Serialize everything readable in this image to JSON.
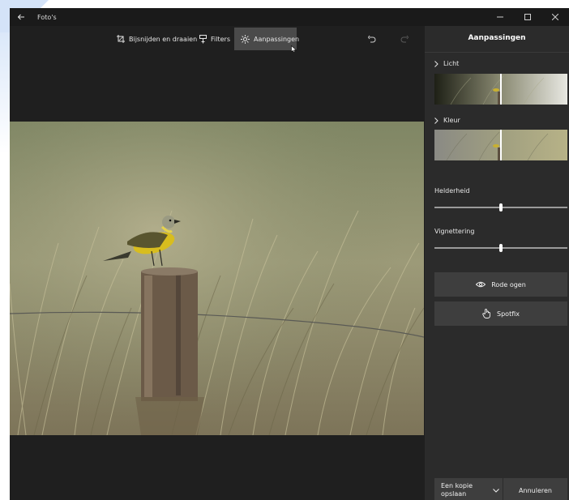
{
  "window": {
    "title": "Foto's",
    "back_icon": "arrow-left-icon",
    "controls": [
      "minimize-icon",
      "maximize-icon",
      "close-icon"
    ]
  },
  "toolbar": {
    "crop_label": "Bijsnijden en draaien",
    "filters_label": "Filters",
    "adjust_label": "Aanpassingen",
    "active_tab": "Aanpassingen"
  },
  "panel": {
    "title": "Aanpassingen",
    "light_label": "Licht",
    "color_label": "Kleur",
    "light_value": 0.5,
    "color_value": 0.5,
    "brightness_label": "Helderheid",
    "brightness_value": 0.5,
    "vignette_label": "Vignettering",
    "vignette_value": 0.5,
    "red_eye_label": "Rode ogen",
    "spotfix_label": "Spotfix",
    "save_copy_label": "Een kopie opslaan",
    "cancel_label": "Annuleren"
  },
  "colors": {
    "window_bg": "#1f1f1f",
    "panel_bg": "#2b2b2b",
    "button_bg": "#3e3e3e",
    "active_tab_bg": "#4a4a4a",
    "bird_yellow": "#e4c41d"
  }
}
